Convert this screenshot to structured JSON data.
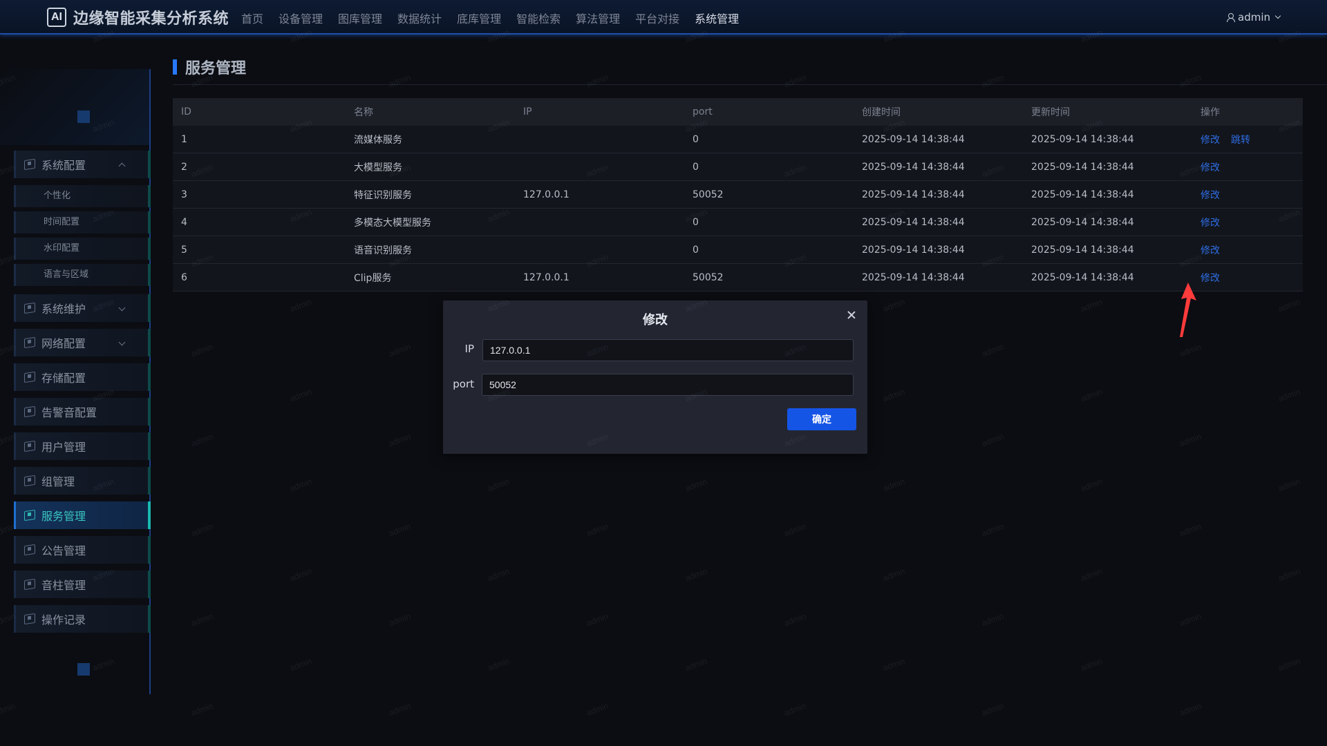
{
  "header": {
    "logo_text": "AI",
    "app_title": "边缘智能采集分析系统",
    "nav": [
      "首页",
      "设备管理",
      "图库管理",
      "数据统计",
      "底库管理",
      "智能检索",
      "算法管理",
      "平台对接",
      "系统管理"
    ],
    "active_nav": "系统管理",
    "user": "admin"
  },
  "sidebar": {
    "groups": [
      {
        "label": "系统配置",
        "expanded": true,
        "children": [
          "个性化",
          "时间配置",
          "水印配置",
          "语言与区域"
        ]
      },
      {
        "label": "系统维护",
        "expandable": true
      },
      {
        "label": "网络配置",
        "expandable": true
      },
      {
        "label": "存储配置"
      },
      {
        "label": "告警音配置"
      },
      {
        "label": "用户管理"
      },
      {
        "label": "组管理"
      },
      {
        "label": "服务管理",
        "active": true
      },
      {
        "label": "公告管理"
      },
      {
        "label": "音柱管理"
      },
      {
        "label": "操作记录"
      }
    ]
  },
  "main": {
    "title": "服务管理",
    "table": {
      "columns": [
        "ID",
        "名称",
        "IP",
        "port",
        "创建时间",
        "更新时间",
        "操作"
      ],
      "rows": [
        {
          "id": "1",
          "name": "流媒体服务",
          "ip": "",
          "port": "0",
          "created": "2025-09-14 14:38:44",
          "updated": "2025-09-14 14:38:44",
          "actions": [
            "修改",
            "跳转"
          ]
        },
        {
          "id": "2",
          "name": "大模型服务",
          "ip": "",
          "port": "0",
          "created": "2025-09-14 14:38:44",
          "updated": "2025-09-14 14:38:44",
          "actions": [
            "修改"
          ]
        },
        {
          "id": "3",
          "name": "特征识别服务",
          "ip": "127.0.0.1",
          "port": "50052",
          "created": "2025-09-14 14:38:44",
          "updated": "2025-09-14 14:38:44",
          "actions": [
            "修改"
          ]
        },
        {
          "id": "4",
          "name": "多模态大模型服务",
          "ip": "",
          "port": "0",
          "created": "2025-09-14 14:38:44",
          "updated": "2025-09-14 14:38:44",
          "actions": [
            "修改"
          ]
        },
        {
          "id": "5",
          "name": "语音识别服务",
          "ip": "",
          "port": "0",
          "created": "2025-09-14 14:38:44",
          "updated": "2025-09-14 14:38:44",
          "actions": [
            "修改"
          ]
        },
        {
          "id": "6",
          "name": "Clip服务",
          "ip": "127.0.0.1",
          "port": "50052",
          "created": "2025-09-14 14:38:44",
          "updated": "2025-09-14 14:38:44",
          "actions": [
            "修改"
          ]
        }
      ]
    }
  },
  "modal": {
    "title": "修改",
    "ip_label": "IP",
    "ip_value": "127.0.0.1",
    "port_label": "port",
    "port_value": "50052",
    "confirm_label": "确定"
  },
  "watermark": "admin",
  "colors": {
    "accent": "#1555e6",
    "link": "#2f6de6",
    "active_menu_text": "#39c6c0",
    "annotation_arrow": "#ff3b3b"
  }
}
